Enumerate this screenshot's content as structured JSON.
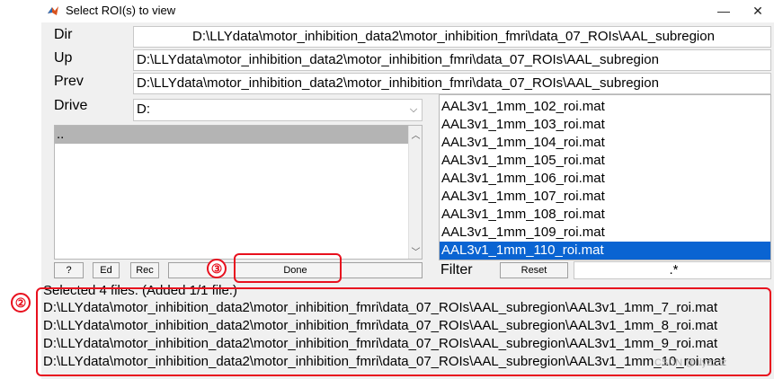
{
  "window": {
    "title": "Select ROI(s) to view",
    "minimize": "—",
    "close": "✕"
  },
  "labels": {
    "dir": "Dir",
    "up": "Up",
    "prev": "Prev",
    "drive": "Drive",
    "filter": "Filter"
  },
  "fields": {
    "dir": "D:\\LLYdata\\motor_inhibition_data2\\motor_inhibition_fmri\\data_07_ROIs\\AAL_subregion",
    "up": "D:\\LLYdata\\motor_inhibition_data2\\motor_inhibition_fmri\\data_07_ROIs\\AAL_subregion",
    "prev": "D:\\LLYdata\\motor_inhibition_data2\\motor_inhibition_fmri\\data_07_ROIs\\AAL_subregion",
    "drive": "D:",
    "filter": ".*"
  },
  "dir_list": [
    ".."
  ],
  "file_list": [
    "AAL3v1_1mm_102_roi.mat",
    "AAL3v1_1mm_103_roi.mat",
    "AAL3v1_1mm_104_roi.mat",
    "AAL3v1_1mm_105_roi.mat",
    "AAL3v1_1mm_106_roi.mat",
    "AAL3v1_1mm_107_roi.mat",
    "AAL3v1_1mm_108_roi.mat",
    "AAL3v1_1mm_109_roi.mat",
    "AAL3v1_1mm_110_roi.mat"
  ],
  "selected_file": "AAL3v1_1mm_110_roi.mat",
  "buttons": {
    "help": "?",
    "ed": "Ed",
    "rec": "Rec",
    "done": "Done",
    "reset": "Reset"
  },
  "status": "Selected 4 files. (Added 1/1 file.)",
  "selected_files": [
    "D:\\LLYdata\\motor_inhibition_data2\\motor_inhibition_fmri\\data_07_ROIs\\AAL_subregion\\AAL3v1_1mm_7_roi.mat",
    "D:\\LLYdata\\motor_inhibition_data2\\motor_inhibition_fmri\\data_07_ROIs\\AAL_subregion\\AAL3v1_1mm_8_roi.mat",
    "D:\\LLYdata\\motor_inhibition_data2\\motor_inhibition_fmri\\data_07_ROIs\\AAL_subregion\\AAL3v1_1mm_9_roi.mat",
    "D:\\LLYdata\\motor_inhibition_data2\\motor_inhibition_fmri\\data_07_ROIs\\AAL_subregion\\AAL3v1_1mm_10_roi.mat"
  ],
  "annotations": {
    "marker2": "②",
    "marker3": "③"
  },
  "watermark": "CSDN @lilyzzzz",
  "colors": {
    "annotation_red": "#e8101e",
    "selection_blue": "#0a64d2"
  }
}
